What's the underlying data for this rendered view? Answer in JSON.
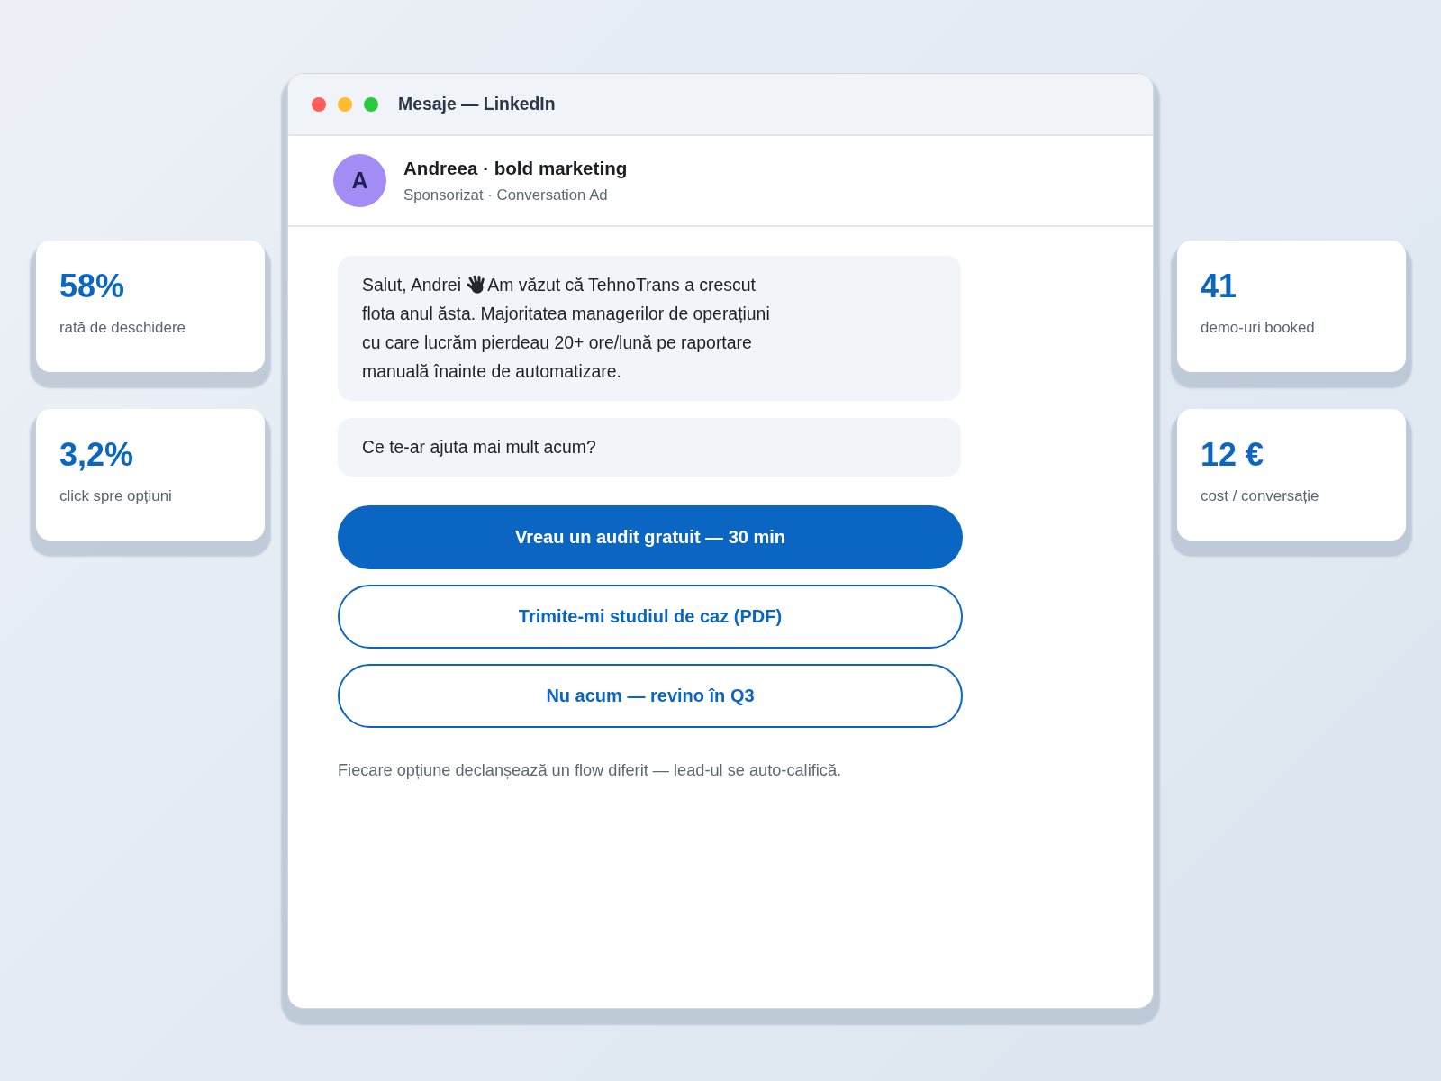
{
  "window": {
    "title": "Mesaje — LinkedIn"
  },
  "conversation": {
    "sender": {
      "initial": "A",
      "name": "Andreea · bold marketing",
      "subtitle": "Sponsorizat · Conversation Ad"
    },
    "messages": [
      {
        "greeting": "Salut, Andrei",
        "text": "Am văzut că TehnoTrans a crescut flota anul ăsta. Majoritatea managerilor de operațiuni cu care lucrăm pierdeau 20+ ore/lună pe raportare manuală înainte de automatizare."
      },
      {
        "text": "Ce te-ar ajuta mai mult acum?"
      }
    ],
    "options": [
      {
        "label": "Vreau un audit gratuit — 30 min",
        "kind": "primary"
      },
      {
        "label": "Trimite-mi studiul de caz (PDF)",
        "kind": "secondary"
      },
      {
        "label": "Nu acum — revino în Q3",
        "kind": "secondary"
      }
    ],
    "note": "Fiecare opțiune declanșează un flow diferit — lead-ul se auto-califică."
  },
  "stats_left": [
    {
      "value": "58%",
      "label": "rată de deschidere"
    },
    {
      "value": "3,2%",
      "label": "click spre opțiuni"
    }
  ],
  "stats_right": [
    {
      "value": "41",
      "label": "demo-uri booked"
    },
    {
      "value": "12 €",
      "label": "cost / conversație"
    }
  ]
}
